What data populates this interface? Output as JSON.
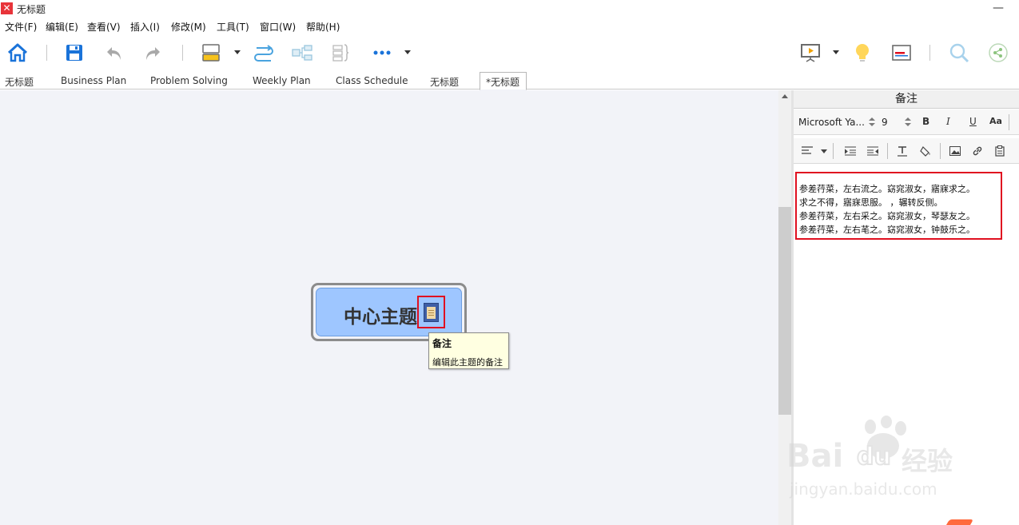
{
  "window": {
    "title": "无标题",
    "minimize_glyph": "—"
  },
  "menu": {
    "items": [
      "文件(F)",
      "编辑(E)",
      "查看(V)",
      "插入(I)",
      "修改(M)",
      "工具(T)",
      "窗口(W)",
      "帮助(H)"
    ]
  },
  "toolbar": {
    "icons": [
      "home-icon",
      "save-icon",
      "undo-icon",
      "redo-icon",
      "topic-style-icon",
      "relationship-icon",
      "structure-icon",
      "boundary-icon",
      "more-icon",
      "presentation-icon",
      "idea-icon",
      "layout-panel-icon",
      "search-icon",
      "share-icon"
    ]
  },
  "tabs": [
    {
      "label": "无标题",
      "active": false
    },
    {
      "label": "Business Plan",
      "active": false
    },
    {
      "label": "Problem Solving",
      "active": false
    },
    {
      "label": "Weekly Plan",
      "active": false
    },
    {
      "label": "Class Schedule",
      "active": false
    },
    {
      "label": "无标题",
      "active": false
    },
    {
      "label": "*无标题",
      "active": true
    }
  ],
  "canvas": {
    "central_topic": "中心主题",
    "topic_color": "#9ec6ff",
    "tooltip": {
      "title": "备注",
      "body": "编辑此主题的备注"
    }
  },
  "notes_panel": {
    "title": "备注",
    "font_name": "Microsoft Ya...",
    "font_size": "9",
    "bold_label": "B",
    "italic_label": "I",
    "underline_label": "U",
    "case_label": "Aa",
    "note_lines": [
      "参差荇菜，左右流之。窈窕淑女，寤寐求之。",
      "求之不得，寤寐思服。        ，辗转反侧。",
      "参差荇菜，左右采之。窈窕淑女，琴瑟友之。",
      "参差荇菜，左右芼之。窈窕淑女，钟鼓乐之。"
    ]
  },
  "watermark": {
    "brand": "Bai",
    "brand2": "du",
    "product": "经验",
    "url": "jingyan.baidu.com"
  },
  "colors": {
    "highlight_red": "#e01020",
    "canvas_bg": "#f2f3f8",
    "accent_blue": "#1a73d9"
  }
}
